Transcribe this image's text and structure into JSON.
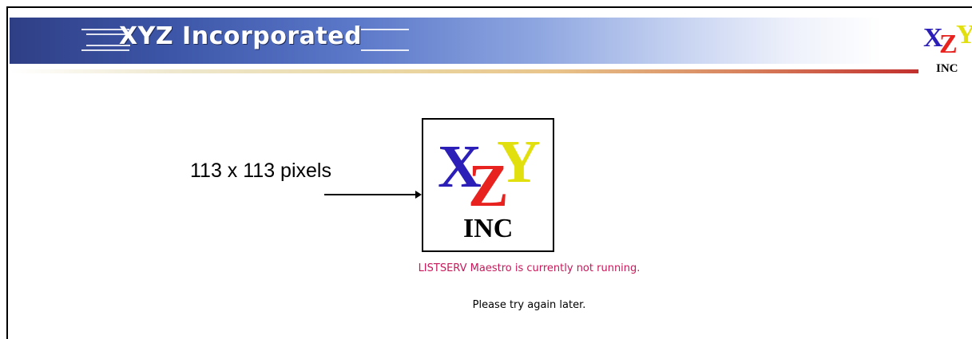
{
  "header": {
    "company_name": "XYZ Incorporated",
    "logo_letters": [
      "X",
      "Z",
      "Y"
    ],
    "logo_sub": "INC"
  },
  "annotation": {
    "size_label": "113 x 113 pixels"
  },
  "messages": {
    "status": "LISTSERV Maestro is currently not running.",
    "retry": "Please try again later."
  },
  "colors": {
    "banner_dark": "#2f3f86",
    "status_text": "#c8185a",
    "logo_blue": "#2b1fb8",
    "logo_red": "#e8231f",
    "logo_yellow": "#e2df0e"
  }
}
